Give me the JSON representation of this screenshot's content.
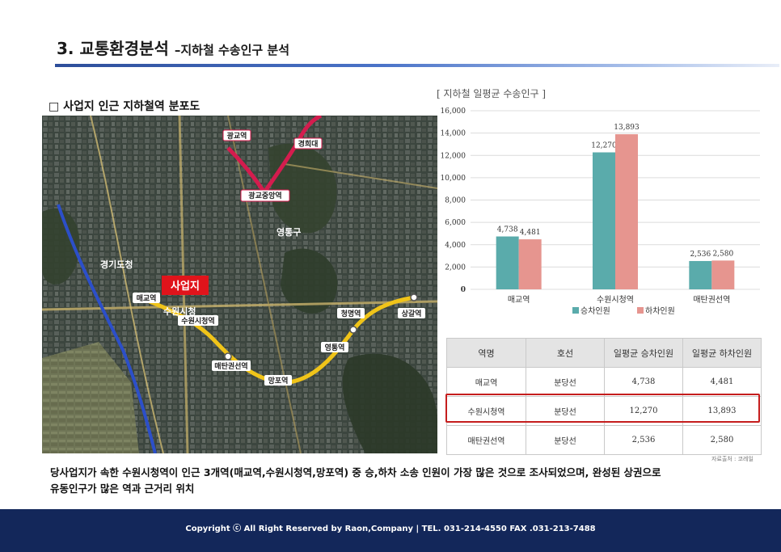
{
  "header": {
    "title_main": "3. 교통환경분석",
    "title_sub": "–지하철 수송인구 분석"
  },
  "map": {
    "heading": "□ 사업지 인근 지하철역 분포도",
    "site_label": "사업지",
    "labels": {
      "area1": "경기도청",
      "area2": "수원시청",
      "area3": "영통구",
      "station1": "광교중앙역",
      "station2": "매교역",
      "station3": "수원시청역",
      "station4": "매탄권선역",
      "station5": "영통역",
      "station6": "망포역",
      "station7": "청명역",
      "station8": "상갈역",
      "line1": "광교역",
      "line2": "경희대"
    }
  },
  "chart_data": {
    "type": "bar",
    "title": "[ 지하철 일평균 수송인구 ]",
    "categories": [
      "매교역",
      "수원시청역",
      "매탄권선역"
    ],
    "series": [
      {
        "name": "승차인원",
        "values": [
          4738,
          12270,
          2536
        ],
        "color": "#5aabab"
      },
      {
        "name": "하차인원",
        "values": [
          4481,
          13893,
          2580
        ],
        "color": "#e6958f"
      }
    ],
    "value_labels": [
      [
        "4,738",
        "12,270",
        "2,536"
      ],
      [
        "4,481",
        "13,893",
        "2,580"
      ]
    ],
    "ylim": [
      0,
      16000
    ],
    "yticks": [
      0,
      2000,
      4000,
      6000,
      8000,
      10000,
      12000,
      14000,
      16000
    ],
    "ytick_labels": [
      "0",
      "2,000",
      "4,000",
      "6,000",
      "8,000",
      "10,000",
      "12,000",
      "14,000",
      "16,000"
    ],
    "grid": true,
    "legend_position": "bottom"
  },
  "table": {
    "headers": [
      "역명",
      "호선",
      "일평균 승차인원",
      "일평균 하차인원"
    ],
    "rows": [
      [
        "매교역",
        "분당선",
        "4,738",
        "4,481"
      ],
      [
        "수원시청역",
        "분당선",
        "12,270",
        "13,893"
      ],
      [
        "매탄권선역",
        "분당선",
        "2,536",
        "2,580"
      ]
    ],
    "source": "자료출처 : 코레일"
  },
  "description": {
    "line1": "당사업지가 속한 수원시청역이 인근 3개역(매교역,수원시청역,망포역) 중 승,하차 소송 인원이 가장 많은 것으로 조사되었으며, 완성된 상권으로",
    "line2": "유동인구가 많은 역과 근거리 위치"
  },
  "footer": {
    "text": "Copyright ⓒ All Right Reserved by Raon,Company |   TEL. 031-214-4550  FAX .031-213-7488"
  },
  "colors": {
    "footer_bg": "#13275a",
    "highlight": "#c51d1d",
    "bar_board": "#5aabab",
    "bar_alight": "#e6958f",
    "route_red": "#d41c4e",
    "route_yellow": "#f0c419",
    "route_blue": "#2c4fc9"
  }
}
